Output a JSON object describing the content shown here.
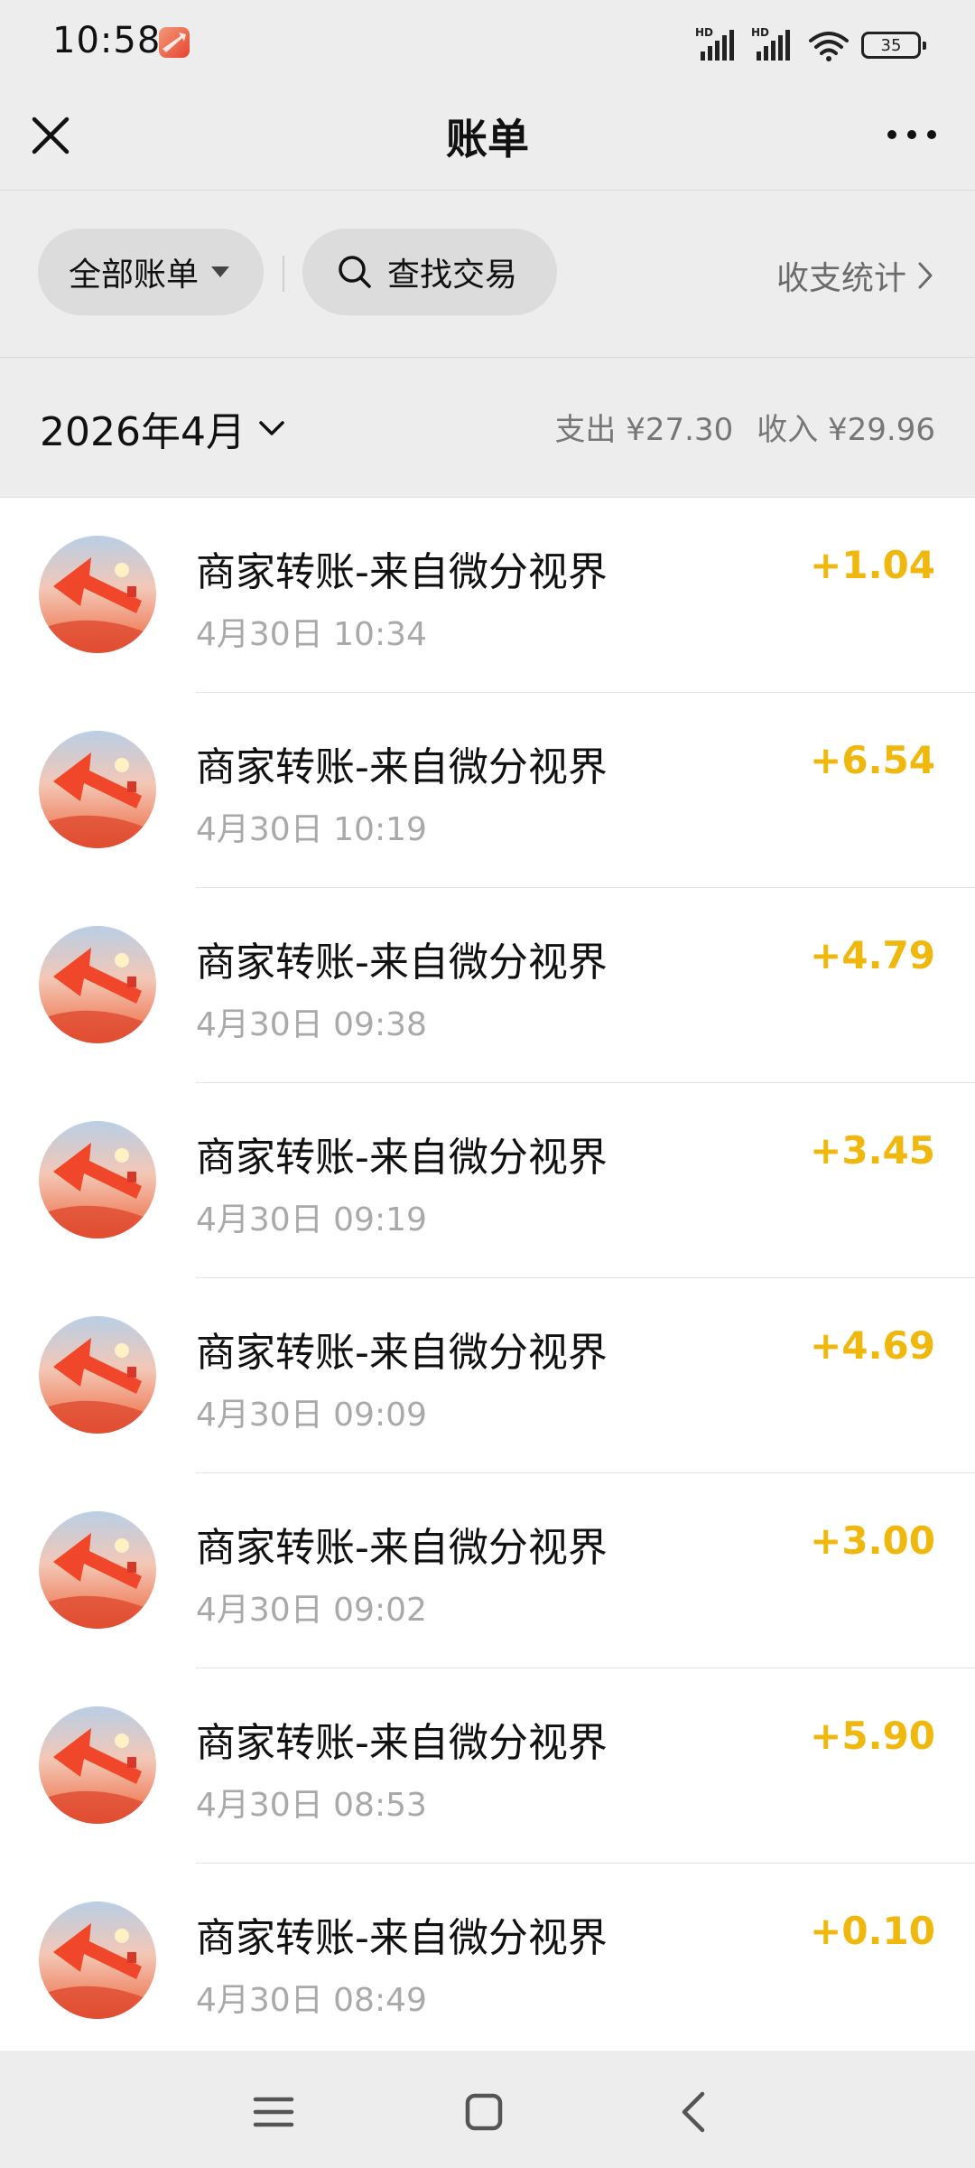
{
  "status": {
    "time": "10:58",
    "signal1_tag": "HD",
    "signal2_tag": "HD",
    "battery": "35"
  },
  "nav": {
    "title": "账单"
  },
  "filters": {
    "all_bills": "全部账单",
    "search": "查找交易",
    "stats": "收支统计"
  },
  "month": {
    "label": "2026年4月",
    "expense": "支出 ¥27.30",
    "income": "收入 ¥29.96"
  },
  "transactions": [
    {
      "title": "商家转账-来自微分视界",
      "time": "4月30日 10:34",
      "amount": "+1.04"
    },
    {
      "title": "商家转账-来自微分视界",
      "time": "4月30日 10:19",
      "amount": "+6.54"
    },
    {
      "title": "商家转账-来自微分视界",
      "time": "4月30日 09:38",
      "amount": "+4.79"
    },
    {
      "title": "商家转账-来自微分视界",
      "time": "4月30日 09:19",
      "amount": "+3.45"
    },
    {
      "title": "商家转账-来自微分视界",
      "time": "4月30日 09:09",
      "amount": "+4.69"
    },
    {
      "title": "商家转账-来自微分视界",
      "time": "4月30日 09:02",
      "amount": "+3.00"
    },
    {
      "title": "商家转账-来自微分视界",
      "time": "4月30日 08:53",
      "amount": "+5.90"
    },
    {
      "title": "商家转账-来自微分视界",
      "time": "4月30日 08:49",
      "amount": "+0.10"
    }
  ],
  "colors": {
    "background": "#ededed",
    "amount": "#f0b70c",
    "muted": "#a9a9a9"
  },
  "icons": {
    "close": "close-icon",
    "more": "more-icon",
    "search": "search-icon",
    "chevron": "chevron-right-icon",
    "dropdown": "chevron-down-icon",
    "menu": "menu-icon",
    "home": "home-icon",
    "back": "back-icon"
  }
}
